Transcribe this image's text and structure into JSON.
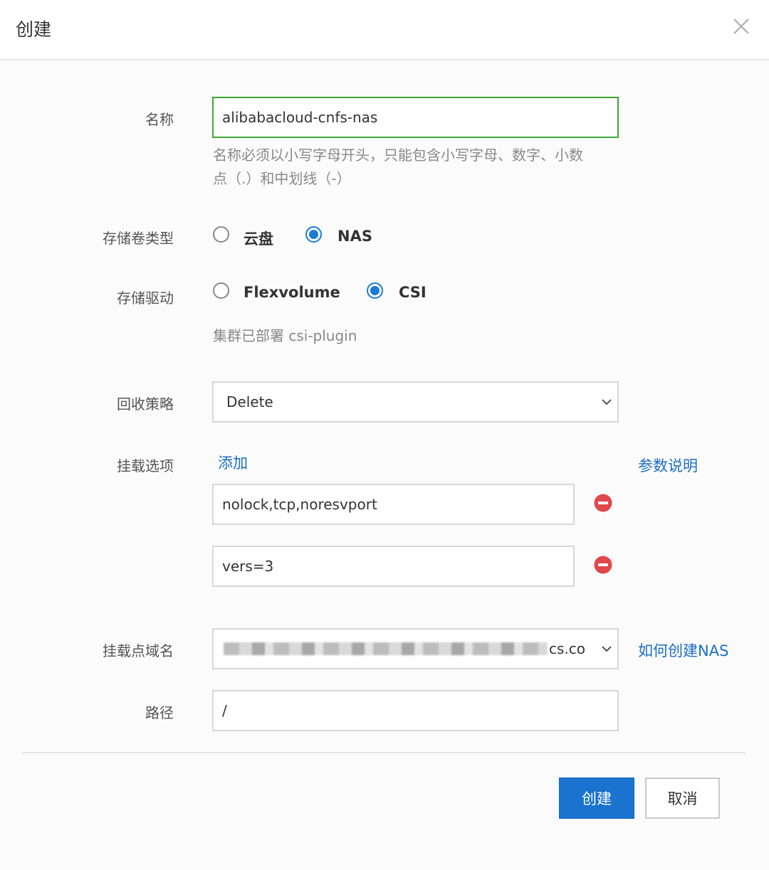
{
  "dialog": {
    "title": "创建",
    "close_icon": "close-icon"
  },
  "form": {
    "name": {
      "label": "名称",
      "value": "alibabacloud-cnfs-nas",
      "hint_line1": "名称必须以小写字母开头，只能包含小写字母、数字、小数",
      "hint_line2": "点（.）和中划线（-）"
    },
    "volume_type": {
      "label": "存储卷类型",
      "options": [
        {
          "label": "云盘",
          "checked": false
        },
        {
          "label": "NAS",
          "checked": true
        }
      ]
    },
    "driver": {
      "label": "存储驱动",
      "options": [
        {
          "label": "Flexvolume",
          "checked": false
        },
        {
          "label": "CSI",
          "checked": true
        }
      ],
      "note": "集群已部署 csi-plugin"
    },
    "reclaim_policy": {
      "label": "回收策略",
      "selected": "Delete"
    },
    "mount_options": {
      "label": "挂载选项",
      "add_link": "添加",
      "help_link": "参数说明",
      "items": [
        {
          "value": "nolock,tcp,noresvport"
        },
        {
          "value": "vers=3"
        }
      ]
    },
    "mount_domain": {
      "label": "挂载点域名",
      "selected_suffix": "cs.co",
      "help_link": "如何创建NAS"
    },
    "path": {
      "label": "路径",
      "value": "/"
    }
  },
  "footer": {
    "create_label": "创建",
    "cancel_label": "取消"
  },
  "colors": {
    "accent": "#1a73cf",
    "focus_border": "#3fa535",
    "remove": "#e0484c"
  }
}
